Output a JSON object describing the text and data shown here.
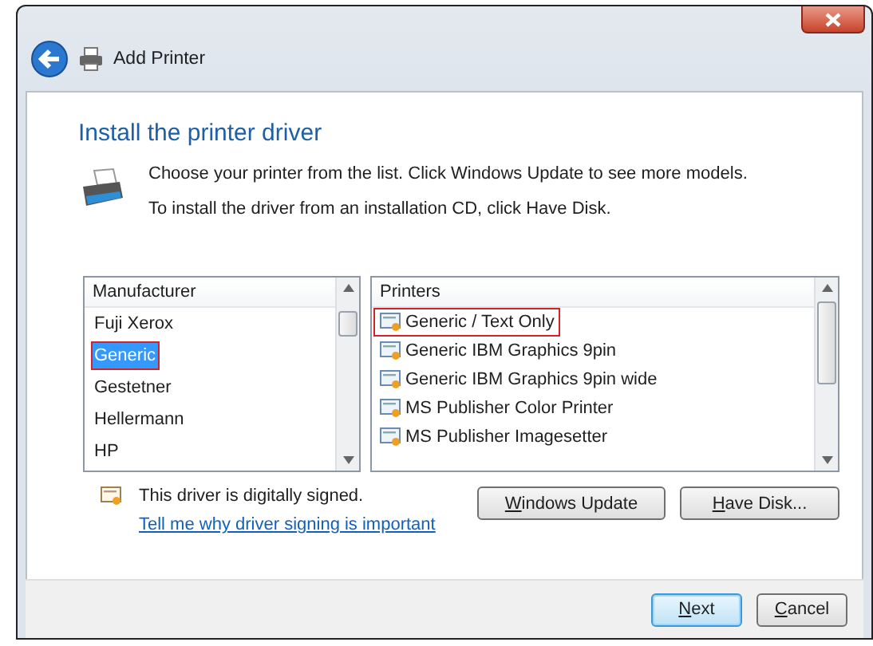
{
  "window": {
    "title": "Add Printer"
  },
  "heading": "Install the printer driver",
  "instructions": [
    "Choose your printer from the list. Click Windows Update to see more models.",
    "To install the driver from an installation CD, click Have Disk."
  ],
  "manufacturers": {
    "header": "Manufacturer",
    "items": [
      {
        "label": "Fuji Xerox",
        "selected": false
      },
      {
        "label": "Generic",
        "selected": true
      },
      {
        "label": "Gestetner",
        "selected": false
      },
      {
        "label": "Hellermann",
        "selected": false
      },
      {
        "label": "HP",
        "selected": false
      }
    ]
  },
  "printers": {
    "header": "Printers",
    "items": [
      {
        "label": "Generic / Text Only",
        "selected": true
      },
      {
        "label": "Generic IBM Graphics 9pin",
        "selected": false
      },
      {
        "label": "Generic IBM Graphics 9pin wide",
        "selected": false
      },
      {
        "label": "MS Publisher Color Printer",
        "selected": false
      },
      {
        "label": "MS Publisher Imagesetter",
        "selected": false
      }
    ]
  },
  "signature": {
    "text": "This driver is digitally signed.",
    "link": "Tell me why driver signing is important"
  },
  "side_buttons": [
    "Windows Update",
    "Have Disk..."
  ],
  "footer_buttons": [
    {
      "label": "Next",
      "default": true
    },
    {
      "label": "Cancel",
      "default": false
    }
  ]
}
